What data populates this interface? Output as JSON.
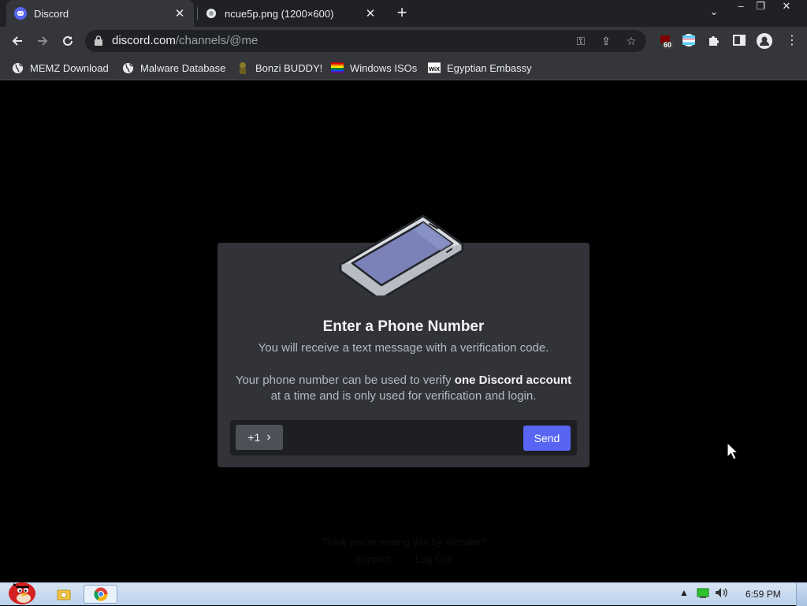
{
  "browser": {
    "tabs": [
      {
        "title": "Discord",
        "active": true,
        "icon": "discord-icon"
      },
      {
        "title": "ncue5p.png (1200×600)",
        "active": false,
        "icon": "image-file-icon"
      }
    ],
    "new_tab_symbol": "+",
    "url_host": "discord.com",
    "url_path": "/channels/@me",
    "extension_badge": "60",
    "window_controls": {
      "minimize": "–",
      "restore": "❐",
      "close": "✕"
    }
  },
  "bookmarks": [
    {
      "label": "MEMZ Download",
      "icon": "globe-icon"
    },
    {
      "label": "Malware Database",
      "icon": "globe-icon"
    },
    {
      "label": "Bonzi BUDDY!",
      "icon": "bonzi-icon"
    },
    {
      "label": "Windows ISOs",
      "icon": "rainbow-flag-icon"
    },
    {
      "label": "Egyptian Embassy",
      "icon": "wix-icon"
    }
  ],
  "modal": {
    "title": "Enter a Phone Number",
    "subtitle": "You will receive a text message with a verification code.",
    "desc_before": "Your phone number can be used to verify ",
    "desc_bold": "one Discord account",
    "desc_after": " at a time and is only used for verification and login.",
    "country_code": "+1",
    "country_chevron": "›",
    "phone_value": "",
    "send_label": "Send"
  },
  "background_page": {
    "line1": "Think you're seeing this by mistake?",
    "support_link": "Support",
    "logout_link": "Log Out"
  },
  "taskbar": {
    "time": "6:59 PM",
    "tray_arrow": "▲"
  },
  "colors": {
    "discord_blurple": "#5865f2",
    "modal_bg": "#313338",
    "input_bg": "#1e1f22"
  }
}
